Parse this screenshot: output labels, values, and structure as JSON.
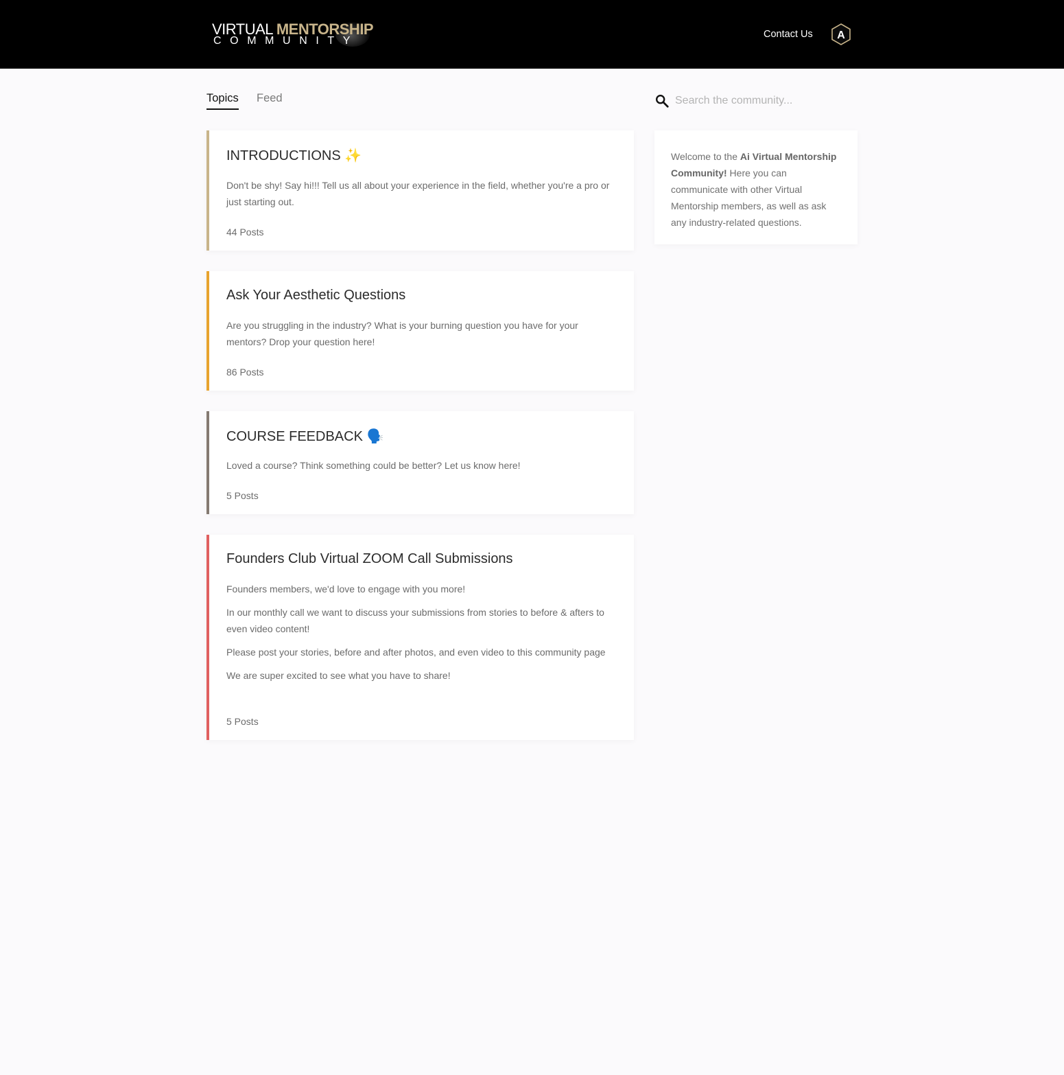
{
  "header": {
    "logo": {
      "word1": "VIRTUAL",
      "word2": "MENTORSHIP",
      "word3": "COMMUNITY"
    },
    "contact_label": "Contact Us",
    "avatar_letter": "A"
  },
  "tabs": [
    {
      "label": "Topics",
      "active": true
    },
    {
      "label": "Feed",
      "active": false
    }
  ],
  "search": {
    "placeholder": "Search the community..."
  },
  "topics": [
    {
      "title": "INTRODUCTIONS ✨",
      "description": [
        "Don't be shy! Say hi!!! Tell us all about your experience in the field, whether you're a pro or just starting out."
      ],
      "count": "44 Posts",
      "accent": "#c8b48a"
    },
    {
      "title": "Ask Your Aesthetic Questions",
      "description": [
        "Are you struggling in the industry? What is your burning question you have for your mentors? Drop your question here!"
      ],
      "count": "86 Posts",
      "accent": "#e8a32e"
    },
    {
      "title": "COURSE FEEDBACK 🗣️",
      "description": [
        "Loved a course? Think something could be better? Let us know here!"
      ],
      "count": "5 Posts",
      "accent": "#857a72"
    },
    {
      "title": "Founders Club Virtual ZOOM Call Submissions",
      "description": [
        "Founders members, we'd love to engage with you more!",
        "In our monthly call we want to discuss your submissions from stories to before & afters to even video content!",
        "Please post your stories, before and after photos, and even video to this community page",
        "We are super excited to see what you have to share!"
      ],
      "count": "5 Posts",
      "accent": "#e06060"
    }
  ],
  "sidebar": {
    "welcome_prefix": "Welcome to the ",
    "welcome_bold": "Ai Virtual Mentorship Community!",
    "welcome_suffix": " Here you can communicate with other Virtual Mentorship members, as well as ask any industry-related questions."
  }
}
